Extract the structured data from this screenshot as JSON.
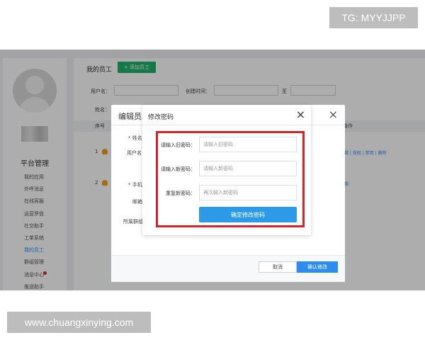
{
  "watermarks": {
    "top": "TG: MYYJJPP",
    "bottom": "www.chuangxinying.com"
  },
  "sidebar": {
    "title": "平台管理",
    "items": [
      {
        "label": "我的应用"
      },
      {
        "label": "外呼消息"
      },
      {
        "label": "在线客服"
      },
      {
        "label": "运营罗盘"
      },
      {
        "label": "社交助手"
      },
      {
        "label": "工单系统"
      },
      {
        "label": "我的员工"
      },
      {
        "label": "群组管理"
      },
      {
        "label": "消息中心"
      },
      {
        "label": "推送助手"
      }
    ],
    "active_index": 6
  },
  "main": {
    "title": "我的员工",
    "add_button": "+ 添加员工",
    "filters": {
      "username_label": "用户名：",
      "created_label": "创建时间：",
      "to_label": "至",
      "name_label": "姓名："
    },
    "table": {
      "headers": [
        "序号",
        "操作"
      ],
      "rows": [
        {
          "index": "1",
          "actions": "编辑 | 授权 | 禁用 | 删除"
        },
        {
          "index": "2",
          "actions": "编辑"
        }
      ]
    }
  },
  "edit_modal": {
    "title": "编辑员工",
    "labels": {
      "name": "* 姓名",
      "username": "用户名",
      "phone": "* 手机",
      "email": "邮箱",
      "group": "所属群组"
    },
    "cancel": "取消",
    "confirm": "确认修改"
  },
  "password_modal": {
    "title": "修改密码",
    "old_label": "请输入旧密码：",
    "old_placeholder": "请输入旧密码",
    "new_label": "请输入新密码：",
    "new_placeholder": "请输入新密码",
    "repeat_label": "重复新密码：",
    "repeat_placeholder": "再次输入新密码",
    "submit": "确定修改密码"
  },
  "colors": {
    "accent": "#2d8cf0",
    "add_green": "#1fb26b",
    "highlight_red": "#d8222a"
  }
}
